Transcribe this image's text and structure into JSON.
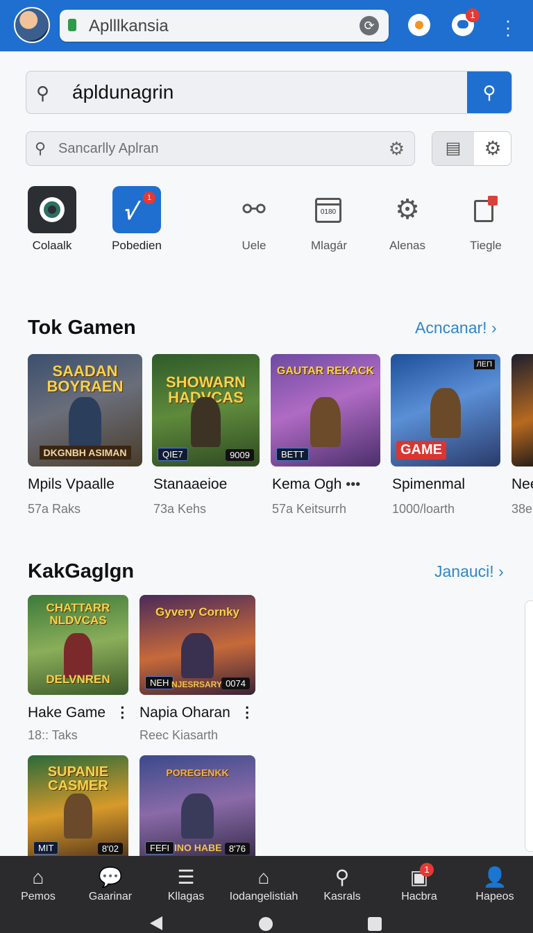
{
  "topbar": {
    "address_text": "Aplllkansia",
    "notification_count": "1"
  },
  "search": {
    "query": "ápldunagrin",
    "placeholder": "Sancarlly Aplran"
  },
  "shortcuts": [
    {
      "label": "Colaalk",
      "icon": "camera-lens-icon"
    },
    {
      "label": "Pobedien",
      "icon": "app-badge-icon",
      "badge": "1"
    },
    {
      "label": "Uele",
      "icon": "link-icon"
    },
    {
      "label": "Mlagár",
      "icon": "calendar-icon",
      "icon_text": "0180"
    },
    {
      "label": "Alenas",
      "icon": "gear-icon"
    },
    {
      "label": "Tiegle",
      "icon": "edit-document-icon"
    }
  ],
  "section1": {
    "title": "Tok Gamen",
    "link": "Acncanar!",
    "cards": [
      {
        "name": "Mpils Vpaalle",
        "sub": "57a Raks",
        "art_title": "SAADAN BOYRAEN",
        "chip_left": "",
        "chip_right": "",
        "banner": "DKGNBH ASIMAN"
      },
      {
        "name": "Stanaaeioe",
        "sub": "73a Kehs",
        "art_title": "SHOWARN HADVCAS",
        "chip_left": "QIE7",
        "chip_right": "9009",
        "banner": ""
      },
      {
        "name": "Kema Ogh",
        "sub": "57a Keitsurrh",
        "art_title": "GAUTAR REKACK",
        "chip_left": "BETT",
        "chip_right": "",
        "banner": ""
      },
      {
        "name": "Spimenmal",
        "sub": "1000/loarth",
        "art_title": "",
        "chip_left": "GAME",
        "chip_right": "ЛЕП",
        "banner": ""
      },
      {
        "name": "Nee",
        "sub": "38e",
        "art_title": "",
        "chip_left": "",
        "chip_right": "",
        "banner": ""
      }
    ]
  },
  "section2": {
    "title": "KakGaglgn",
    "link": "Janauci!",
    "cards": [
      {
        "name": "Hake Game",
        "sub": "18:: Taks",
        "art_title": "CHATTARR NLDVCAS",
        "chip_left": "",
        "chip_right": "",
        "banner": "DELVNREN"
      },
      {
        "name": "Napia Oharan",
        "sub": "Reec Kiasarth",
        "art_title": "Gyvery Cornky",
        "chip_left": "NEH",
        "chip_right": "0074",
        "banner": "NJESRSARY"
      },
      {
        "name": "",
        "sub": "",
        "art_title": "SUPANIE CASMER",
        "chip_left": "MIT",
        "chip_right": "8'02",
        "banner": ""
      },
      {
        "name": "",
        "sub": "",
        "art_title": "POREGENKK",
        "chip_left": "FEFI",
        "chip_right": "8'76",
        "banner": "INO HABE"
      }
    ]
  },
  "bottom_nav": [
    {
      "label": "Pemos",
      "icon": "home-icon"
    },
    {
      "label": "Gaarinar",
      "icon": "chat-icon"
    },
    {
      "label": "Kllagas",
      "icon": "list-icon"
    },
    {
      "label": "Iodangelistiah",
      "icon": "home-icon"
    },
    {
      "label": "Kasrals",
      "icon": "search-icon"
    },
    {
      "label": "Hacbra",
      "icon": "message-icon",
      "badge": "1"
    },
    {
      "label": "Hapeos",
      "icon": "person-icon"
    }
  ],
  "colors": {
    "topbar": "#1f6fd1",
    "accent_link": "#2e86c9",
    "badge": "#e53935",
    "nav_bg": "#2b2b2d"
  }
}
